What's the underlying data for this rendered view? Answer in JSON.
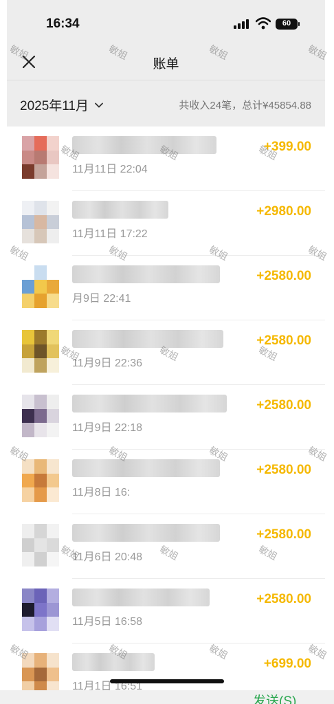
{
  "status_bar": {
    "time": "16:34",
    "battery": "60"
  },
  "nav": {
    "title": "账单"
  },
  "summary": {
    "month": "2025年11月",
    "total_text": "共收入24笔，总计¥45854.88"
  },
  "accent_color": "#f5b800",
  "transactions": [
    {
      "date": "11月11日 22:04",
      "amount": "+399.00"
    },
    {
      "date": "11月11日 17:22",
      "amount": "+2980.00"
    },
    {
      "date": "月9日 22:41",
      "amount": "+2580.00"
    },
    {
      "date": "11月9日 22:36",
      "amount": "+2580.00"
    },
    {
      "date": "11月9日 22:18",
      "amount": "+2580.00"
    },
    {
      "date": "11月8日 16:",
      "amount": "+2580.00"
    },
    {
      "date": "11月6日 20:48",
      "amount": "+2580.00"
    },
    {
      "date": "11月5日 16:58",
      "amount": "+2580.00"
    },
    {
      "date": "11月1日 16:51",
      "amount": "+699.00"
    }
  ],
  "bottom": {
    "send_label": "发送(S)"
  },
  "watermark_text": "敏姐"
}
